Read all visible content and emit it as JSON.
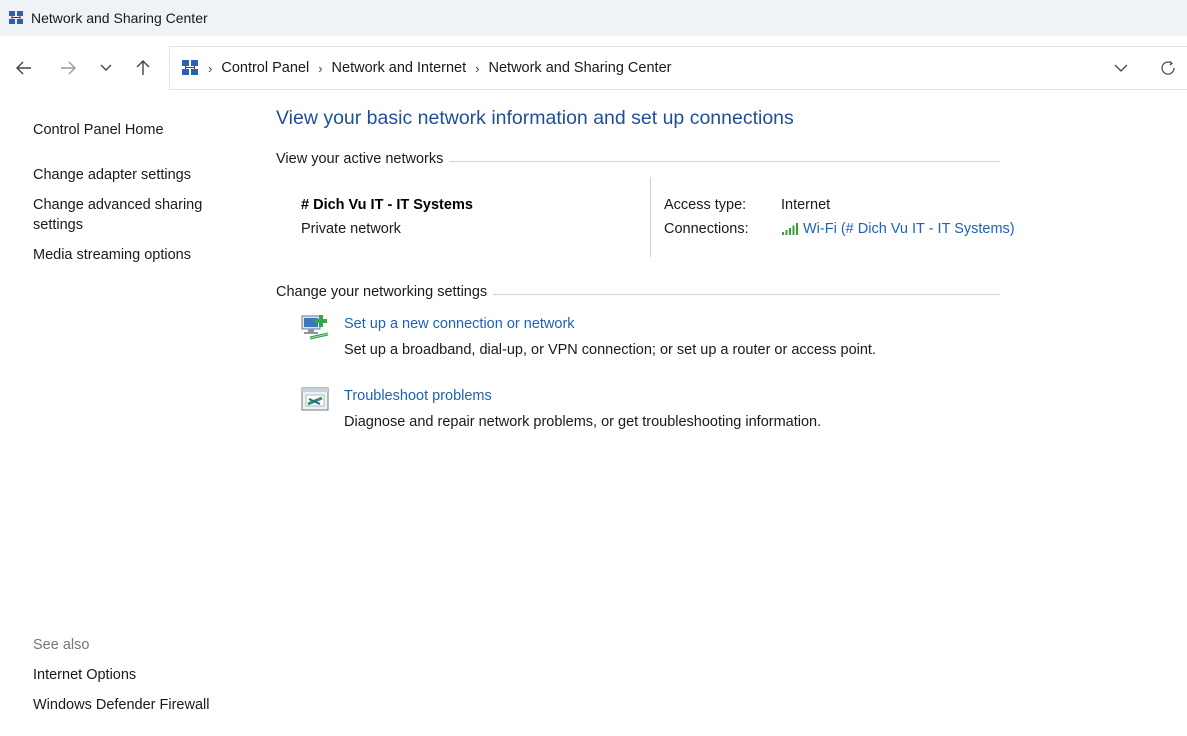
{
  "window": {
    "title": "Network and Sharing Center"
  },
  "nav": {
    "back_icon": "arrow-left-icon",
    "forward_icon": "arrow-right-icon",
    "recent_icon": "chevron-down-icon",
    "up_icon": "arrow-up-icon",
    "breadcrumbs": [
      "Control Panel",
      "Network and Internet",
      "Network and Sharing Center"
    ],
    "refresh_icon": "refresh-icon"
  },
  "sidebar": {
    "links": [
      "Control Panel Home",
      "Change adapter settings",
      "Change advanced sharing settings",
      "Media streaming options"
    ],
    "see_also_label": "See also",
    "see_also": [
      "Internet Options",
      "Windows Defender Firewall"
    ]
  },
  "main": {
    "heading": "View your basic network information and set up connections",
    "active_networks": {
      "title": "View your active networks",
      "network_name": "# Dich Vu IT - IT Systems",
      "network_category": "Private network",
      "access_type_label": "Access type:",
      "access_type_value": "Internet",
      "connections_label": "Connections:",
      "connection_link": "Wi-Fi (# Dich Vu IT - IT Systems)"
    },
    "networking_settings": {
      "title": "Change your networking settings",
      "tasks": [
        {
          "icon": "new-connection-icon",
          "link": "Set up a new connection or network",
          "description": "Set up a broadband, dial-up, or VPN connection; or set up a router or access point."
        },
        {
          "icon": "troubleshoot-icon",
          "link": "Troubleshoot problems",
          "description": "Diagnose and repair network problems, or get troubleshooting information."
        }
      ]
    }
  },
  "colors": {
    "link": "#1c62b9",
    "heading": "#1e4f9a",
    "titlebar_bg": "#eef3f7",
    "wifi_signal": "#3aa13a"
  }
}
